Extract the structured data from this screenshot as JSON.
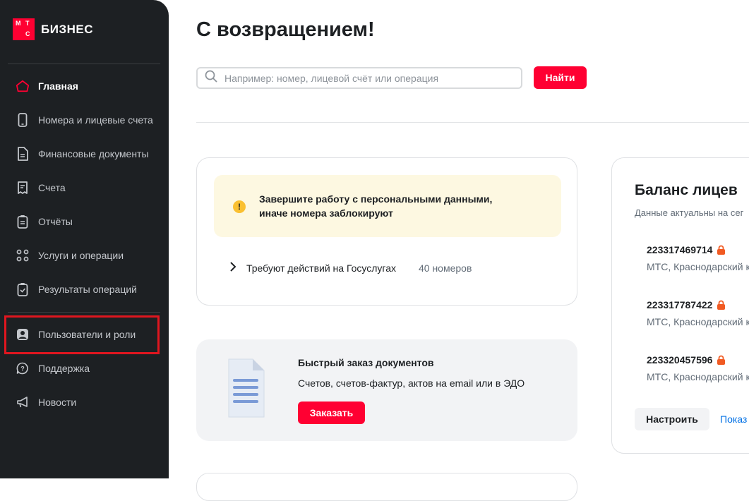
{
  "brand": {
    "logo_letters": [
      "М",
      "Т",
      "С"
    ],
    "name": "БИЗНЕС",
    "accent": "#ff0032"
  },
  "sidebar": {
    "items": [
      {
        "label": "Главная",
        "icon": "home-icon"
      },
      {
        "label": "Номера и лицевые счета",
        "icon": "phone-icon"
      },
      {
        "label": "Финансовые документы",
        "icon": "document-icon"
      },
      {
        "label": "Счета",
        "icon": "receipt-icon"
      },
      {
        "label": "Отчёты",
        "icon": "clipboard-icon"
      },
      {
        "label": "Услуги и операции",
        "icon": "grid-icon"
      },
      {
        "label": "Результаты операций",
        "icon": "clipboard-check-icon"
      },
      {
        "label": "Пользователи и роли",
        "icon": "user-icon"
      },
      {
        "label": "Поддержка",
        "icon": "help-icon"
      },
      {
        "label": "Новости",
        "icon": "megaphone-icon"
      }
    ]
  },
  "main": {
    "title": "С возвращением!",
    "search": {
      "placeholder": "Например: номер, лицевой счёт или операция",
      "button": "Найти"
    },
    "warning": {
      "text": "Завершите работу с персональными данными, иначе номера заблокируют",
      "row_label": "Требуют действий на Госуслугах",
      "row_count": "40 номеров"
    },
    "quick_order": {
      "title": "Быстрый заказ документов",
      "subtitle": "Счетов, счетов-фактур, актов на email или в ЭДО",
      "button": "Заказать"
    },
    "balance": {
      "title": "Баланс лицев",
      "subtitle": "Данные актуальны на сег",
      "accounts": [
        {
          "number": "223317469714",
          "region": "МТС, Краснодарский к"
        },
        {
          "number": "223317787422",
          "region": "МТС, Краснодарский к"
        },
        {
          "number": "223320457596",
          "region": "МТС, Краснодарский к"
        }
      ],
      "setup_button": "Настроить",
      "show_link": "Показ"
    }
  }
}
